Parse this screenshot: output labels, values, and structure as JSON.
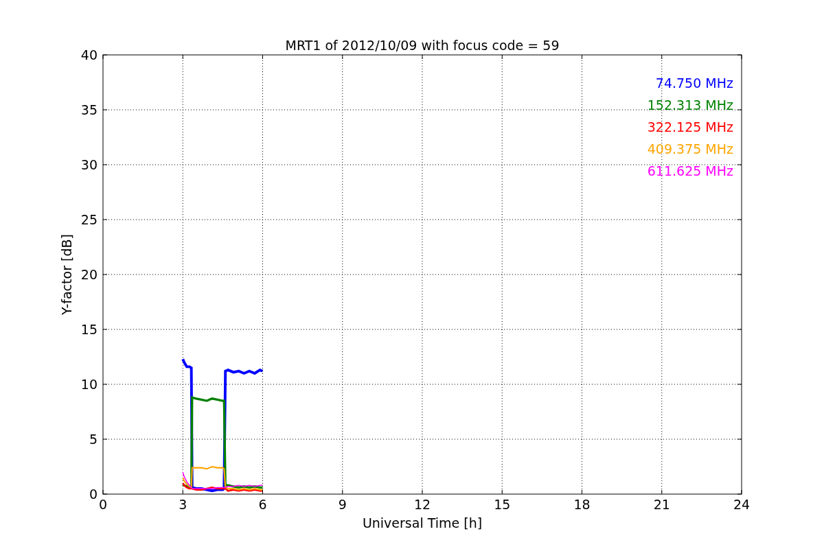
{
  "figure": {
    "chart_data": {
      "type": "line",
      "title": "MRT1 of 2012/10/09 with focus code = 59",
      "xlabel": "Universal Time [h]",
      "ylabel": "Y-factor [dB]",
      "x": [
        3.0,
        3.05,
        3.15,
        3.25,
        3.32,
        3.35,
        3.5,
        3.7,
        3.9,
        4.1,
        4.3,
        4.5,
        4.55,
        4.6,
        4.7,
        4.9,
        5.1,
        5.3,
        5.5,
        5.7,
        5.9,
        6.0
      ],
      "series": [
        {
          "name": "74.750 MHz",
          "color": "#0000ff",
          "values": [
            12.3,
            12.0,
            11.6,
            11.6,
            11.5,
            0.6,
            0.5,
            0.5,
            0.4,
            0.3,
            0.4,
            0.4,
            0.5,
            11.2,
            11.3,
            11.1,
            11.2,
            11.0,
            11.2,
            11.0,
            11.3,
            11.2
          ]
        },
        {
          "name": "152.313 MHz",
          "color": "#008000",
          "values": [
            0.9,
            0.8,
            0.7,
            0.6,
            0.6,
            8.8,
            8.7,
            8.6,
            8.5,
            8.7,
            8.6,
            8.5,
            8.5,
            0.8,
            0.8,
            0.7,
            0.6,
            0.7,
            0.6,
            0.7,
            0.6,
            0.6
          ]
        },
        {
          "name": "322.125 MHz",
          "color": "#ff0000",
          "values": [
            1.0,
            0.8,
            0.6,
            0.5,
            0.5,
            0.5,
            0.4,
            0.4,
            0.5,
            0.6,
            0.5,
            0.5,
            0.5,
            0.5,
            0.3,
            0.4,
            0.3,
            0.4,
            0.3,
            0.4,
            0.3,
            0.3
          ]
        },
        {
          "name": "409.375 MHz",
          "color": "#ffa500",
          "values": [
            1.5,
            1.2,
            0.9,
            0.7,
            0.6,
            2.4,
            2.4,
            2.4,
            2.3,
            2.5,
            2.4,
            2.4,
            2.3,
            0.6,
            0.5,
            0.5,
            0.4,
            0.5,
            0.4,
            0.5,
            0.4,
            0.4
          ]
        },
        {
          "name": "611.625 MHz",
          "color": "#ff00ff",
          "values": [
            2.0,
            1.6,
            1.1,
            0.8,
            0.6,
            0.5,
            0.5,
            0.5,
            0.5,
            0.5,
            0.6,
            0.6,
            0.6,
            0.6,
            0.7,
            0.7,
            0.8,
            0.7,
            0.8,
            0.7,
            0.8,
            0.8
          ]
        }
      ],
      "grid": true,
      "xlim": [
        0,
        24
      ],
      "ylim": [
        0,
        40
      ],
      "xticks": [
        0,
        3,
        6,
        9,
        12,
        15,
        18,
        21,
        24
      ],
      "yticks": [
        0,
        5,
        10,
        15,
        20,
        25,
        30,
        35,
        40
      ]
    }
  }
}
